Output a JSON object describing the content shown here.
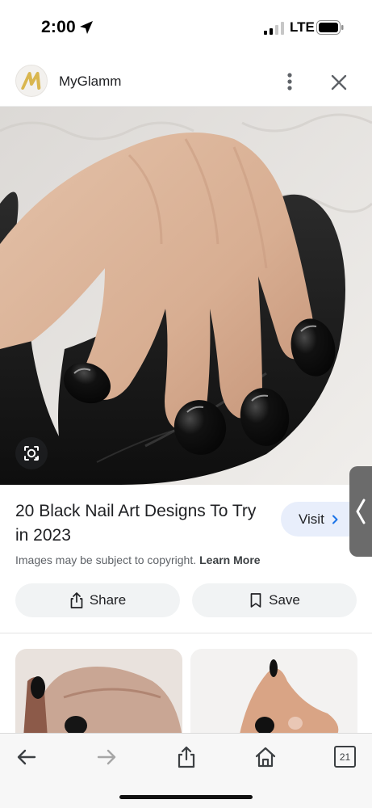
{
  "status_bar": {
    "time": "2:00",
    "network": "LTE",
    "icons": [
      "location-arrow-icon",
      "signal-icon",
      "battery-icon"
    ]
  },
  "source": {
    "name": "MyGlamm",
    "logo_letter": "M",
    "logo_color": "#d9b64f",
    "icons": [
      "more-vertical-icon",
      "close-icon"
    ]
  },
  "image": {
    "icons": [
      "lens-icon"
    ]
  },
  "result": {
    "title": "20 Black Nail Art Designs To Try in 2023",
    "visit_label": "Visit",
    "copyright_text": "Images may be subject to copyright.",
    "learn_more": "Learn More"
  },
  "actions": {
    "share_label": "Share",
    "save_label": "Save"
  },
  "toolbar": {
    "tab_count": "21",
    "icons": [
      "back-arrow-icon",
      "forward-arrow-icon",
      "share-icon",
      "home-icon",
      "tabs-icon"
    ]
  },
  "colors": {
    "visit_bg": "#e8eefb",
    "visit_chevron": "#1a73e8",
    "pill_bg": "#f1f3f4",
    "side_panel": "#6b6b6b"
  }
}
